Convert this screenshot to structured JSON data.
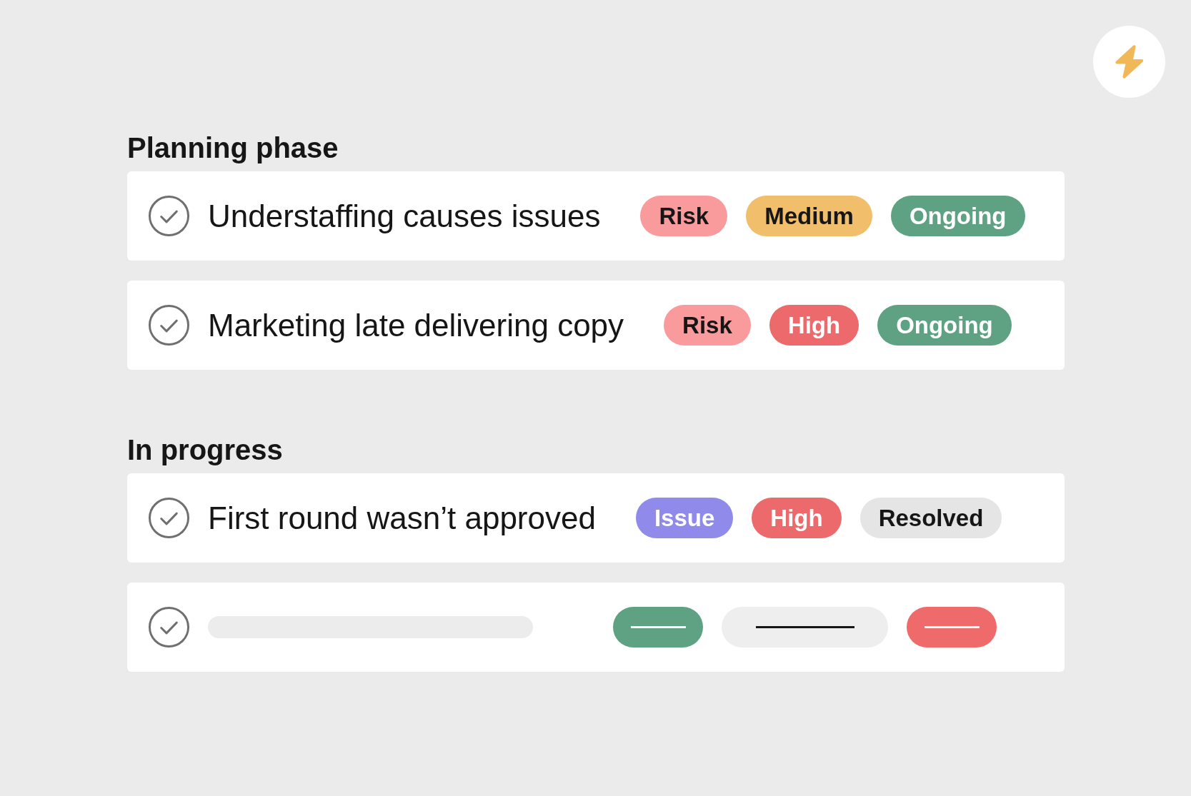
{
  "sections": [
    {
      "title": "Planning phase",
      "rows": [
        {
          "kind": "task",
          "title": "Understaffing causes issues",
          "completed": false,
          "tags": [
            {
              "label": "Risk",
              "color": "#f99a9c"
            },
            {
              "label": "Medium",
              "color": "#f1bf6c"
            },
            {
              "label": "Ongoing",
              "color": "#5ea283"
            }
          ]
        },
        {
          "kind": "task",
          "title": "Marketing late delivering copy",
          "completed": false,
          "tags": [
            {
              "label": "Risk",
              "color": "#f99a9c"
            },
            {
              "label": "High",
              "color": "#ec6a6b"
            },
            {
              "label": "Ongoing",
              "color": "#5ea283"
            }
          ]
        }
      ]
    },
    {
      "title": "In progress",
      "rows": [
        {
          "kind": "task",
          "title": "First round wasn’t approved",
          "completed": false,
          "tags": [
            {
              "label": "Issue",
              "color": "#908aeb"
            },
            {
              "label": "High",
              "color": "#ec6a6b"
            },
            {
              "label": "Resolved",
              "color": "#e5e5e5"
            }
          ]
        },
        {
          "kind": "placeholder",
          "completed": false,
          "tags": [
            {
              "kind": "short",
              "color": "#5ea283"
            },
            {
              "kind": "long",
              "color": "#eeeeee"
            },
            {
              "kind": "short",
              "color": "#ef6b6b"
            }
          ]
        }
      ]
    }
  ]
}
